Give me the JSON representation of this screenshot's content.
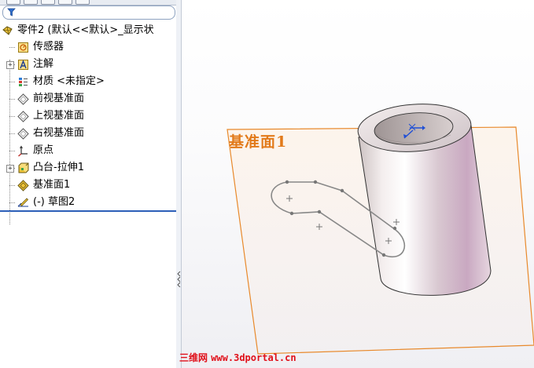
{
  "feature_tree": {
    "part": "零件2 (默认<<默认>_显示状",
    "items": [
      {
        "label": "传感器",
        "icon": "sensor-icon"
      },
      {
        "label": "注解",
        "icon": "annotation-icon",
        "expandable": true
      },
      {
        "label": "材质 <未指定>",
        "icon": "material-icon"
      },
      {
        "label": "前视基准面",
        "icon": "plane-icon"
      },
      {
        "label": "上视基准面",
        "icon": "plane-icon"
      },
      {
        "label": "右视基准面",
        "icon": "plane-icon"
      },
      {
        "label": "原点",
        "icon": "origin-icon"
      },
      {
        "label": "凸台-拉伸1",
        "icon": "extrude-icon",
        "expandable": true
      },
      {
        "label": "基准面1",
        "icon": "plane-highlight-icon"
      },
      {
        "label": "(-) 草图2",
        "icon": "sketch-icon"
      }
    ]
  },
  "viewport": {
    "plane_label": "基准面1"
  },
  "watermark": {
    "cn": "三维网",
    "url": "www.3dportal.cn"
  },
  "colors": {
    "plane_edge": "#e8892b",
    "plane_label": "#e27a1a",
    "rollback_bar": "#2c5fb8",
    "watermark": "#e0101a"
  }
}
